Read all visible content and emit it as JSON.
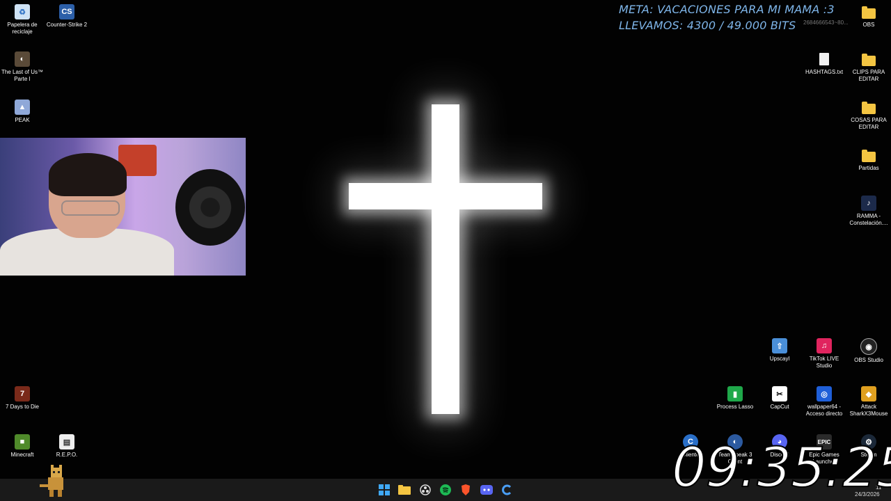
{
  "stream_overlay": {
    "goal_line1": "META: VACACIONES PARA MI MAMA :3",
    "goal_line2": "LLEVAMOS: 4300 / 49.000 BITS",
    "faint_text": "2684666543~80...",
    "clock": "09:35:25"
  },
  "desktop_icons": [
    {
      "label": "Papelera de reciclaje",
      "icon": "recycle-bin-icon"
    },
    {
      "label": "Counter-Strike 2",
      "icon": "counter-strike-icon"
    },
    {
      "label": "The Last of Us™ Parte I",
      "icon": "last-of-us-icon"
    },
    {
      "label": "PEAK",
      "icon": "peak-icon"
    },
    {
      "label": "7 Days to Die",
      "icon": "seven-days-icon"
    },
    {
      "label": "Minecraft",
      "icon": "minecraft-icon"
    },
    {
      "label": "R.E.P.O.",
      "icon": "repo-icon"
    },
    {
      "label": "OBS",
      "icon": "folder-icon"
    },
    {
      "label": "HASHTAGS.txt",
      "icon": "text-file-icon"
    },
    {
      "label": "CLIPS PARA EDITAR",
      "icon": "folder-icon"
    },
    {
      "label": "COSAS PARA EDITAR",
      "icon": "folder-icon"
    },
    {
      "label": "Partidas",
      "icon": "folder-icon"
    },
    {
      "label": "RAMMA - Constelación....",
      "icon": "ramma-icon"
    },
    {
      "label": "Upscayl",
      "icon": "upscayl-icon"
    },
    {
      "label": "TikTok LIVE Studio",
      "icon": "tiktok-icon"
    },
    {
      "label": "OBS Studio",
      "icon": "obs-studio-icon"
    },
    {
      "label": "Process Lasso",
      "icon": "process-lasso-icon"
    },
    {
      "label": "CapCut",
      "icon": "capcut-icon"
    },
    {
      "label": "wallpaper64 - Acceso directo",
      "icon": "wallpaper-engine-icon"
    },
    {
      "label": "Attack SharkX3Mouse",
      "icon": "attack-shark-icon"
    },
    {
      "label": "Cliente",
      "icon": "cliente-icon"
    },
    {
      "label": "TeamSpeak 3 Client",
      "icon": "teamspeak-icon"
    },
    {
      "label": "Discord",
      "icon": "discord-icon"
    },
    {
      "label": "Epic Games Launcher",
      "icon": "epic-games-icon"
    },
    {
      "label": "Steam",
      "icon": "steam-icon"
    }
  ],
  "taskbar": {
    "apps": [
      "windows-start-icon",
      "file-explorer-icon",
      "obs-icon",
      "spotify-icon",
      "brave-icon",
      "discord-icon",
      "cliente-icon"
    ],
    "date": "24/3/2026",
    "time_partial": "11"
  },
  "colors": {
    "goal_text": "#7fb6ea",
    "folder": "#f4c542",
    "desktop_bg": "#020202",
    "taskbar_bg": "#1a1a1a"
  }
}
